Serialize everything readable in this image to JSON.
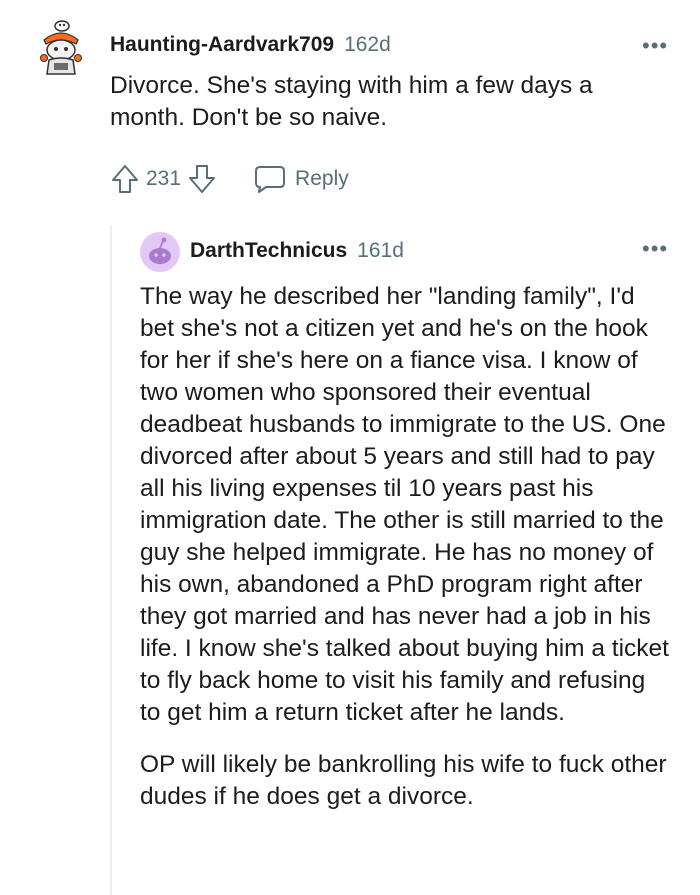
{
  "comment": {
    "username": "Haunting-Aardvark709",
    "age": "162d",
    "body": "Divorce. She's staying with him a few days a month. Don't be so naive.",
    "votes": "231",
    "reply_label": "Reply",
    "more_label": "•••",
    "icons": {
      "avatar": "snoo-avatar-icon",
      "upvote": "upvote-arrow-icon",
      "downvote": "downvote-arrow-icon",
      "reply": "comment-bubble-icon"
    }
  },
  "reply": {
    "username": "DarthTechnicus",
    "age": "161d",
    "paragraphs": [
      "The way he described her \"landing family\", I'd bet she's not a citizen yet and he's on the hook for her if she's here on a fiance visa. I know of two women who sponsored their eventual deadbeat husbands to immigrate to the US. One divorced after about 5 years and still had to pay all his living expenses til 10 years past his immigration date. The other is still married to the guy she helped immigrate. He has no money of his own, abandoned a PhD program right after they got married and has never had a job in his life. I know she's talked about buying him a ticket to fly back home to visit his family and refusing to get him a return ticket after he lands.",
      "OP will likely be bankrolling his wife to fuck other dudes if he does get a divorce."
    ],
    "more_label": "•••",
    "icons": {
      "avatar": "default-snoo-avatar-icon"
    },
    "colors": {
      "avatar_bg": "#e3c8f5",
      "avatar_fg": "#a87bd1"
    }
  },
  "colors": {
    "meta": "#576f76",
    "text": "#1c1c1c",
    "thread": "#edeff1"
  }
}
